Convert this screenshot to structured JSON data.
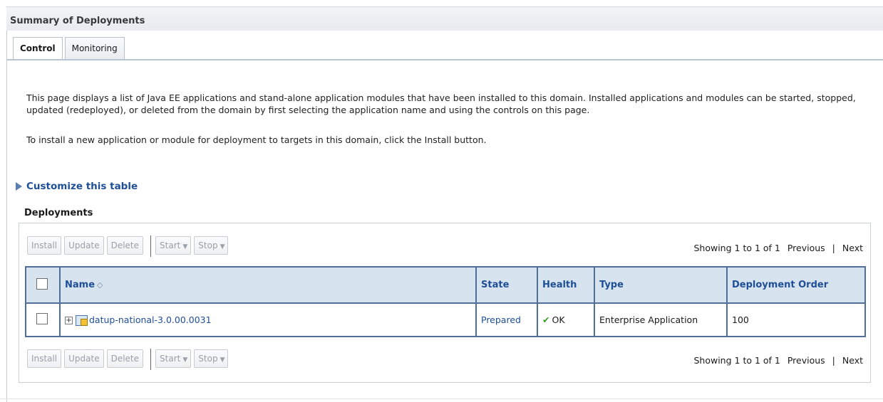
{
  "header": {
    "title": "Summary of Deployments"
  },
  "tabs": [
    {
      "label": "Control",
      "active": true
    },
    {
      "label": "Monitoring",
      "active": false
    }
  ],
  "description": {
    "para1": "This page displays a list of Java EE applications and stand-alone application modules that have been installed to this domain. Installed applications and modules can be started, stopped, updated (redeployed), or deleted from the domain by first selecting the application name and using the controls on this page.",
    "para2": "To install a new application or module for deployment to targets in this domain, click the Install button."
  },
  "customize": {
    "label": "Customize this table"
  },
  "deployments": {
    "title": "Deployments",
    "toolbar": {
      "install": "Install",
      "update": "Update",
      "delete": "Delete",
      "start": "Start",
      "stop": "Stop"
    },
    "paging": {
      "showing": "Showing 1 to 1 of 1",
      "previous": "Previous",
      "separator": "|",
      "next": "Next"
    },
    "columns": {
      "name": "Name",
      "state": "State",
      "health": "Health",
      "type": "Type",
      "order": "Deployment Order"
    },
    "rows": [
      {
        "name": "datup-national-3.0.00.0031",
        "state": "Prepared",
        "health": "OK",
        "type": "Enterprise Application",
        "order": "100"
      }
    ]
  },
  "colors": {
    "link": "#1f4f96",
    "table_border": "#4f6f99",
    "header_bg": "#d7e3ef",
    "ok_green": "#3a9b2a"
  }
}
